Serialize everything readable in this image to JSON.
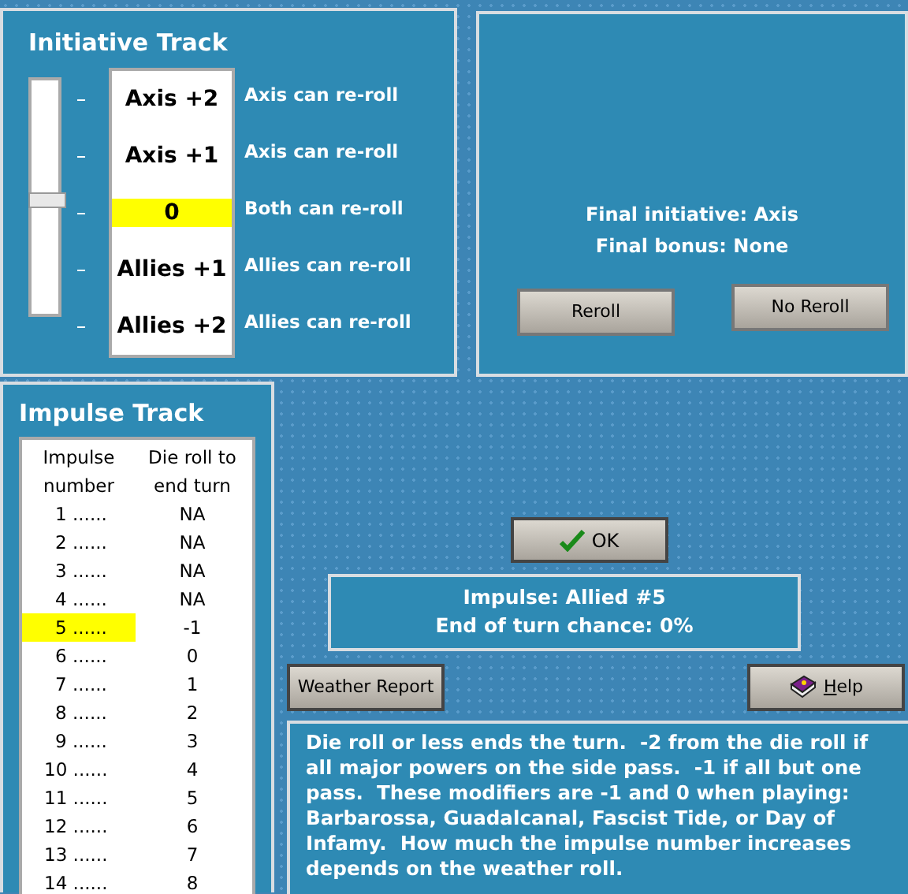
{
  "initiative": {
    "title": "Initiative Track",
    "slider": {
      "level": 0.5
    },
    "levels": [
      {
        "label": "Axis +2",
        "note": "Axis can re-roll",
        "selected": false
      },
      {
        "label": "Axis +1",
        "note": "Axis can re-roll",
        "selected": false
      },
      {
        "label": "0",
        "note": "Both can re-roll",
        "selected": true
      },
      {
        "label": "Allies +1",
        "note": "Allies can re-roll",
        "selected": false
      },
      {
        "label": "Allies +2",
        "note": "Allies can re-roll",
        "selected": false
      }
    ]
  },
  "result": {
    "lines": [
      "Final initiative: Axis",
      "Final bonus: None"
    ],
    "buttons": [
      "Reroll",
      "No Reroll"
    ]
  },
  "impulse": {
    "title": "Impulse Track",
    "columns": [
      "Impulse number",
      "Die roll to end turn"
    ],
    "rows": [
      {
        "number": "1 ......",
        "roll": "NA",
        "selected": false
      },
      {
        "number": "2 ......",
        "roll": "NA",
        "selected": false
      },
      {
        "number": "3 ......",
        "roll": "NA",
        "selected": false
      },
      {
        "number": "4 ......",
        "roll": "NA",
        "selected": false
      },
      {
        "number": "5 ......",
        "roll": "-1",
        "selected": true
      },
      {
        "number": "6 ......",
        "roll": "0",
        "selected": false
      },
      {
        "number": "7 ......",
        "roll": "1",
        "selected": false
      },
      {
        "number": "8 ......",
        "roll": "2",
        "selected": false
      },
      {
        "number": "9 ......",
        "roll": "3",
        "selected": false
      },
      {
        "number": "10 ......",
        "roll": "4",
        "selected": false
      },
      {
        "number": "11 ......",
        "roll": "5",
        "selected": false
      },
      {
        "number": "12 ......",
        "roll": "6",
        "selected": false
      },
      {
        "number": "13 ......",
        "roll": "7",
        "selected": false
      },
      {
        "number": "14 ......",
        "roll": "8",
        "selected": false
      }
    ]
  },
  "ok_button": "OK",
  "status": [
    "Impulse: Allied #5",
    "End of turn chance: 0%"
  ],
  "weather_button": "Weather Report",
  "help_button": {
    "label": "Help",
    "mnemonic_underlined": true
  },
  "explanation": "Die roll or less ends the turn.  -2 from the die roll if all major powers on the side pass.  -1 if all but one pass.  These modifiers are -1 and 0 when playing: Barbarossa, Guadalcanal, Fascist Tide, or Day of Infamy.  How much the impulse number increases depends on the weather roll."
}
